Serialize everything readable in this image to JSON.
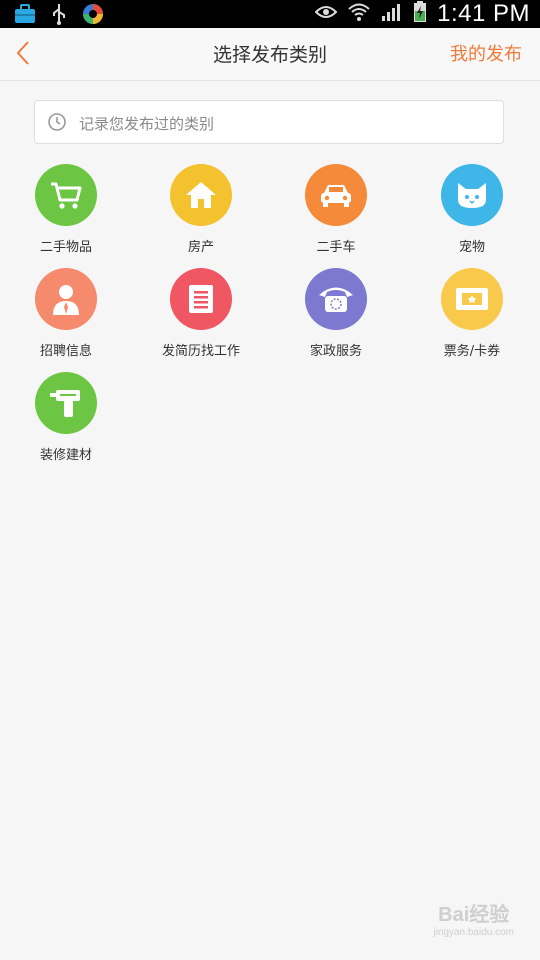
{
  "status_bar": {
    "time": "1:41 PM",
    "icons": [
      "briefcase-icon",
      "usb-icon",
      "sync-app-icon",
      "eye-icon",
      "wifi-icon",
      "signal-icon",
      "battery-charging-icon"
    ]
  },
  "header": {
    "title": "选择发布类别",
    "right_action": "我的发布",
    "back_icon": "chevron-left-icon"
  },
  "search": {
    "placeholder": "记录您发布过的类别",
    "icon": "clock-icon"
  },
  "categories": [
    {
      "label": "二手物品",
      "icon": "cart-icon",
      "color": "#6cc644"
    },
    {
      "label": "房产",
      "icon": "house-icon",
      "color": "#f4c12f"
    },
    {
      "label": "二手车",
      "icon": "car-icon",
      "color": "#f58b3a"
    },
    {
      "label": "宠物",
      "icon": "cat-icon",
      "color": "#3fb6e8"
    },
    {
      "label": "招聘信息",
      "icon": "person-icon",
      "color": "#f58a6c"
    },
    {
      "label": "发简历找工作",
      "icon": "resume-icon",
      "color": "#ef5763"
    },
    {
      "label": "家政服务",
      "icon": "phone-icon",
      "color": "#7d79d0"
    },
    {
      "label": "票务/卡券",
      "icon": "ticket-icon",
      "color": "#f9c94c"
    },
    {
      "label": "装修建材",
      "icon": "drill-icon",
      "color": "#6cc644"
    }
  ],
  "colors": {
    "accent": "#f07a3a",
    "background": "#f6f6f6"
  },
  "watermark": {
    "main": "Bai经验",
    "sub": "jingyan.baidu.com"
  }
}
